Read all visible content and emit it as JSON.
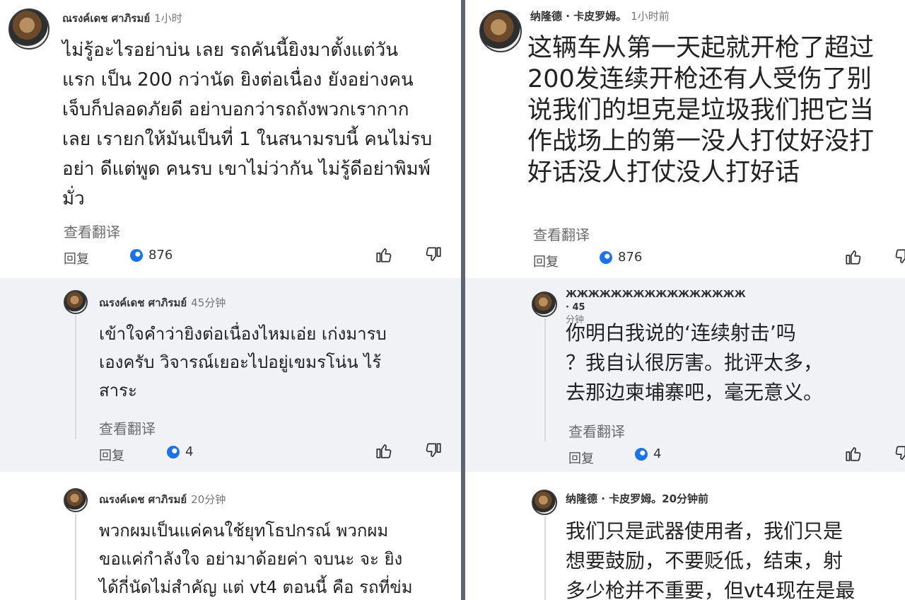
{
  "common": {
    "see_translation": "查看翻译",
    "reply": "回复"
  },
  "left": {
    "c1": {
      "author": "ณรงค์เดช ศาภิรมย์",
      "time": "1小时",
      "lines": [
        "ไม่รู้อะไรอย่าบ่น เลย รถคันนี้ยิงมาตั้งแต่วัน",
        "แรก เป็น 200 กว่านัด ยิงต่อเนื่อง ยังอย่างคน",
        "เจ็บก็ปลอดภัยดี อย่าบอกว่ารถถังพวกเรากาก",
        "เลย เรายกให้มันเป็นที่ 1 ในสนามรบนี้ คนไม่รบ",
        "อย่า ดีแต่พูด คนรบ เขาไม่ว่ากัน ไม่รู้ดีอย่าพิมพ์",
        "มั่ว"
      ],
      "likes": "876"
    },
    "c2": {
      "author": "ณรงค์เดช ศาภิรมย์",
      "time": "45分钟",
      "lines": [
        "เข้าใจคำว่ายิงต่อเนื่องไหมเอ่ย เก่งมารบ",
        "เองครับ วิจารณ์เยอะไปอยู่เขมรโน่น ไร้",
        "สาระ"
      ],
      "likes": "4"
    },
    "c3": {
      "author": "ณรงค์เดช ศาภิรมย์",
      "time": "20分钟",
      "lines": [
        "พวกผมเป็นแค่คนใช้ยุทโธปกรณ์ พวกผม",
        "ขอแค่กำลังใจ อย่ามาด้อยค่า จบนะ จะ ยิง",
        "ได้กี่นัดไม่สำคัญ แต่ vt4 ตอนนี้ คือ รถที่ข่ม"
      ]
    }
  },
  "right": {
    "c1": {
      "author": "纳隆德 · 卡皮罗姆。",
      "time": "1小时前",
      "lines": [
        "这辆车从第一天起就开枪了超过",
        "200发连续开枪还有人受伤了别",
        "说我们的坦克是垃圾我们把它当",
        "作战场上的第一没人打仗好没打",
        "好话没人打仗没人打好话"
      ],
      "likes": "876"
    },
    "c2": {
      "author": "ЖЖЖЖЖЖЖЖЖЖЖЖЖЖЖЖ · 45",
      "time": "分钟",
      "lines": [
        "你明白我说的‘连续射击’吗",
        "？我自认很厉害。批评太多，",
        "去那边柬埔寨吧，毫无意义。"
      ],
      "likes": "4"
    },
    "c3": {
      "author": "纳隆德 · 卡皮罗姆。20分钟前",
      "lines": [
        "我们只是武器使用者，我们只是",
        "想要鼓励，不要贬低，结束，射",
        "多少枪并不重要，但vt4现在是最"
      ]
    }
  },
  "colors": {
    "band": "#f0f2f6",
    "like_icon": "#1a73e8",
    "divider": "#5f6470"
  },
  "icons": [
    "like-count-icon",
    "thumb-up-icon",
    "thumb-down-icon"
  ]
}
